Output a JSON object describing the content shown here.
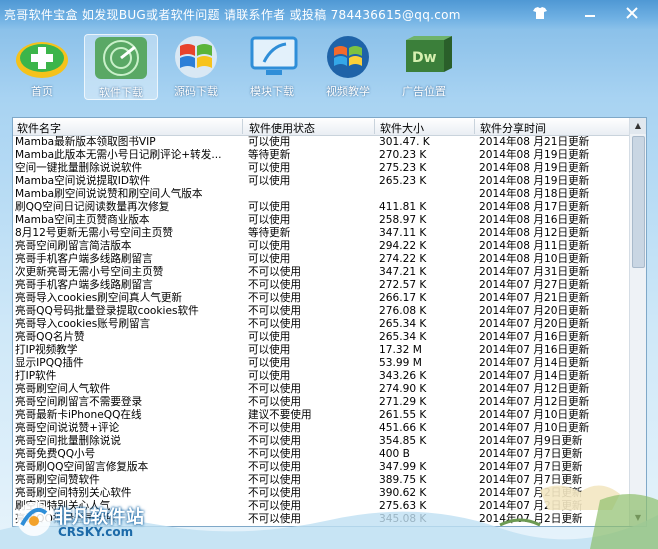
{
  "window": {
    "title": "亮哥软件宝盒   如发现BUG或者软件问题  请联系作者  或投稿 784436615@qq.com",
    "buttons": [
      "shirt-icon",
      "minimize-icon",
      "close-icon"
    ]
  },
  "toolbar": {
    "items": [
      {
        "label": "首页",
        "icon": "home-plus-icon"
      },
      {
        "label": "软件下载",
        "icon": "radar-icon"
      },
      {
        "label": "源码下载",
        "icon": "windows-logo-icon"
      },
      {
        "label": "模块下载",
        "icon": "monitor-icon"
      },
      {
        "label": "视频教学",
        "icon": "windows-orb-icon"
      },
      {
        "label": "广告位置",
        "icon": "dw-box-icon"
      }
    ],
    "active_index": 1
  },
  "table": {
    "headers": [
      "软件名字",
      "软件使用状态",
      "软件大小",
      "软件分享时间"
    ],
    "rows": [
      [
        "Mamba最新版本领取图书VIP",
        "可以使用",
        "301.47. K",
        "2014年08 月21日更新"
      ],
      [
        "Mamba此版本无需小号日记刷评论+转发...",
        "等待更新",
        "270.23 K",
        "2014年08 月19日更新"
      ],
      [
        "空间一键批量删除说说软件",
        "可以使用",
        "275.23 K",
        "2014年08 月19日更新"
      ],
      [
        "Mamba空间说说提取ID软件",
        "可以使用",
        "265.23 K",
        "2014年08 月19日更新"
      ],
      [
        "Mamba刷空间说说赞和刷空间人气版本",
        "",
        "",
        "2014年08 月18日更新"
      ],
      [
        "刷QQ空间日记阅读数量再次修复",
        "可以使用",
        "411.81 K",
        "2014年08 月17日更新"
      ],
      [
        "Mamba空间主页赞商业版本",
        "可以使用",
        "258.97 K",
        "2014年08 月16日更新"
      ],
      [
        "8月12号更新无需小号空间主页赞",
        "等待更新",
        "347.11 K",
        "2014年08 月12日更新"
      ],
      [
        "亮哥空间刷留言简洁版本",
        "可以使用",
        "294.22 K",
        "2014年08 月11日更新"
      ],
      [
        "亮哥手机客户端多线路刷留言",
        "可以使用",
        "274.22 K",
        "2014年08 月10日更新"
      ],
      [
        "次更新亮哥无需小号空间主页赞",
        "不可以使用",
        "347.21 K",
        "2014年07 月31日更新"
      ],
      [
        "亮哥手机客户端多线路刷留言",
        "不可以使用",
        "272.57 K",
        "2014年07 月27日更新"
      ],
      [
        "亮哥导入cookies刷空间真人气更新",
        "不可以使用",
        "266.17 K",
        "2014年07 月21日更新"
      ],
      [
        "亮哥QQ号码批量登录提取cookies软件",
        "不可以使用",
        "276.08 K",
        "2014年07 月20日更新"
      ],
      [
        "亮哥导入cookies账号刷留言",
        "不可以使用",
        "265.34 K",
        "2014年07 月20日更新"
      ],
      [
        "亮哥QQ名片赞",
        "可以使用",
        "265.34 K",
        "2014年07 月16日更新"
      ],
      [
        "打IP视频教学",
        "可以使用",
        "17.32 M",
        "2014年07 月16日更新"
      ],
      [
        "显示IPQQ插件",
        "可以使用",
        "53.99 M",
        "2014年07 月14日更新"
      ],
      [
        "打IP软件",
        "可以使用",
        "343.26 K",
        "2014年07 月14日更新"
      ],
      [
        "亮哥刷空间人气软件",
        "不可以使用",
        "274.90 K",
        "2014年07 月12日更新"
      ],
      [
        "亮哥空间刷留言不需要登录",
        "不可以使用",
        "271.29 K",
        "2014年07 月12日更新"
      ],
      [
        "亮哥最新卡iPhoneQQ在线",
        "建议不要使用",
        "261.55 K",
        "2014年07 月10日更新"
      ],
      [
        "亮哥空间说说赞+评论",
        "不可以使用",
        "451.66 K",
        "2014年07 月10日更新"
      ],
      [
        "亮哥空间批量删除说说",
        "不可以使用",
        "354.85 K",
        "2014年07 月9日更新"
      ],
      [
        "亮哥免费QQ小号",
        "不可以使用",
        "400 B",
        "2014年07 月7日更新"
      ],
      [
        "亮哥刷QQ空间留言修复版本",
        "不可以使用",
        "347.99 K",
        "2014年07 月7日更新"
      ],
      [
        "亮哥刷空间赞软件",
        "不可以使用",
        "389.75 K",
        "2014年07 月7日更新"
      ],
      [
        "亮哥刷空间特别关心软件",
        "不可以使用",
        "390.62 K",
        "2014年07 月2日更新"
      ],
      [
        "刷空间特别关心人气",
        "不可以使用",
        "275.63 K",
        "2014年07 月2日更新"
      ],
      [
        "亮哥QQ批量登录提取",
        "不可以使用",
        "345.08 K",
        "2014年07 月2日更新"
      ]
    ]
  },
  "watermark": {
    "cn": "非凡软件站",
    "en": "CRSKY.com"
  }
}
